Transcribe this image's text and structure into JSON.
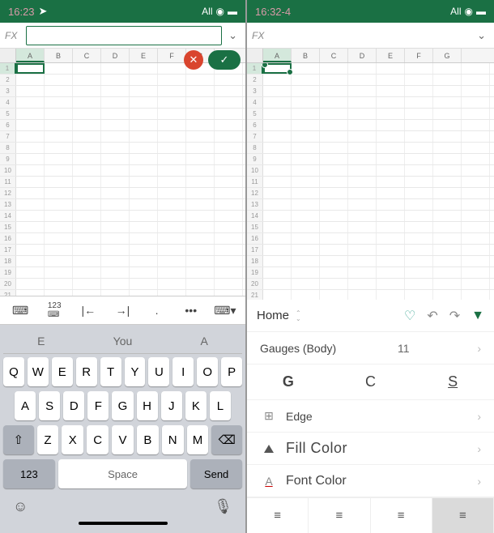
{
  "left": {
    "status": {
      "time": "16:23",
      "network": "All"
    },
    "fx_label": "FX",
    "columns": [
      "A",
      "B",
      "C",
      "D",
      "E",
      "F",
      "G"
    ],
    "rows_visible": 22,
    "selected_col": "A",
    "selected_row": 1,
    "cancel_icon": "✕",
    "confirm_icon": "✓",
    "toolbar_icons": [
      "keyboard",
      "numpad",
      "tab-left",
      "tab-right",
      "dot",
      "more",
      "hide-kb"
    ],
    "suggestions": [
      "E",
      "You",
      "A"
    ],
    "key_rows": [
      [
        "Q",
        "W",
        "E",
        "R",
        "T",
        "Y",
        "U",
        "I",
        "O",
        "P"
      ],
      [
        "A",
        "S",
        "D",
        "F",
        "G",
        "H",
        "J",
        "K",
        "L"
      ],
      [
        "⇧",
        "Z",
        "X",
        "C",
        "V",
        "B",
        "N",
        "M",
        "⌫"
      ]
    ],
    "key_123": "123",
    "key_space": "Space",
    "key_send": "Send",
    "emoji": "☺",
    "mic": "🎤"
  },
  "right": {
    "status": {
      "time": "16:32-4",
      "network": "All"
    },
    "fx_label": "FX",
    "columns": [
      "A",
      "B",
      "C",
      "D",
      "E",
      "F",
      "G"
    ],
    "rows_visible": 24,
    "tab_name": "Home",
    "font_row": {
      "label": "Gauges (Body)",
      "value": "11"
    },
    "bcs": {
      "b": "G",
      "c": "C",
      "s": "S"
    },
    "edge_label": "Edge",
    "fill_label": "Fill Color",
    "font_color_label": "Font Color",
    "align_icons": [
      "≡",
      "≡",
      "≡",
      "≡"
    ]
  }
}
